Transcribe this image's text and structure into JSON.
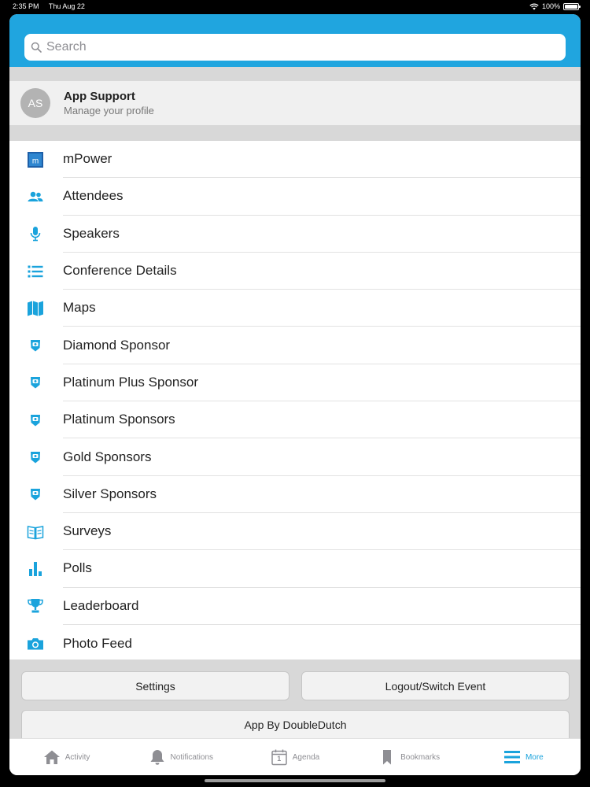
{
  "status": {
    "time": "2:35 PM",
    "date": "Thu Aug 22",
    "battery": "100%"
  },
  "search": {
    "placeholder": "Search"
  },
  "profile": {
    "initials": "AS",
    "name": "App Support",
    "subtitle": "Manage your profile"
  },
  "menu": {
    "items": [
      {
        "label": "mPower",
        "icon": "mpower-logo-icon"
      },
      {
        "label": "Attendees",
        "icon": "people-icon"
      },
      {
        "label": "Speakers",
        "icon": "microphone-icon"
      },
      {
        "label": "Conference Details",
        "icon": "list-icon"
      },
      {
        "label": "Maps",
        "icon": "map-icon"
      },
      {
        "label": "Diamond Sponsor",
        "icon": "sponsor-badge-icon"
      },
      {
        "label": "Platinum Plus Sponsor",
        "icon": "sponsor-badge-icon"
      },
      {
        "label": "Platinum Sponsors",
        "icon": "sponsor-badge-icon"
      },
      {
        "label": "Gold Sponsors",
        "icon": "sponsor-badge-icon"
      },
      {
        "label": "Silver Sponsors",
        "icon": "sponsor-badge-icon"
      },
      {
        "label": "Surveys",
        "icon": "survey-book-icon"
      },
      {
        "label": "Polls",
        "icon": "bar-chart-icon"
      },
      {
        "label": "Leaderboard",
        "icon": "trophy-icon"
      },
      {
        "label": "Photo Feed",
        "icon": "camera-icon"
      }
    ]
  },
  "buttons": {
    "settings": "Settings",
    "logout": "Logout/Switch Event",
    "credit": "App By DoubleDutch"
  },
  "tabs": [
    {
      "label": "Activity",
      "icon": "home-icon"
    },
    {
      "label": "Notifications",
      "icon": "bell-icon"
    },
    {
      "label": "Agenda",
      "icon": "calendar-icon",
      "badge": "1"
    },
    {
      "label": "Bookmarks",
      "icon": "bookmark-icon"
    },
    {
      "label": "More",
      "icon": "menu-icon",
      "active": true
    }
  ],
  "colors": {
    "accent": "#20a5df",
    "icon": "#1aa3dc",
    "tab_inactive": "#8e8e93"
  }
}
